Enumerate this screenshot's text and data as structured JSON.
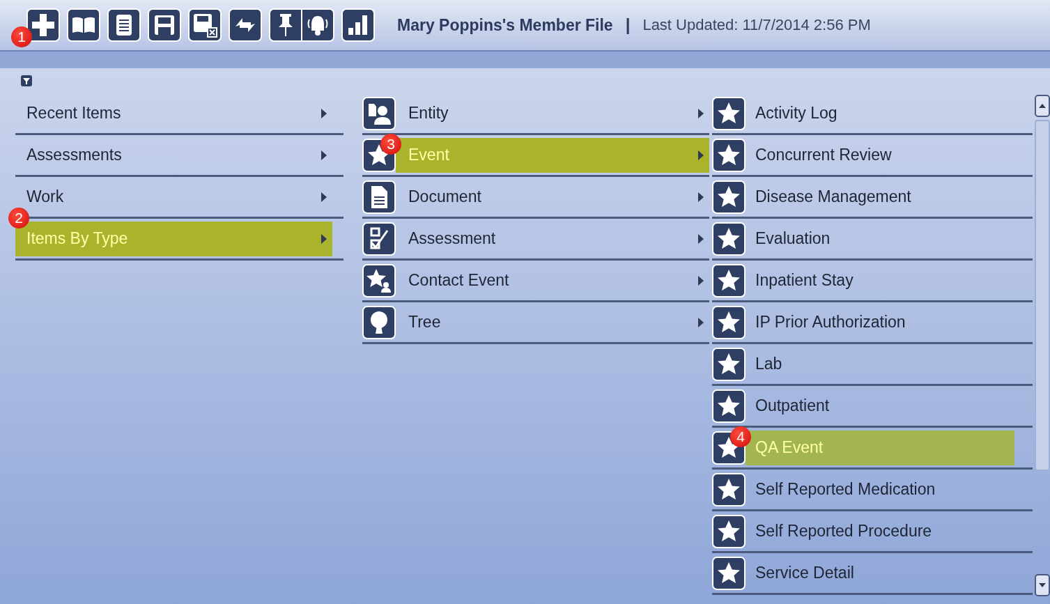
{
  "toolbar": {
    "buttons": [
      {
        "kind": "plus",
        "badge": "1"
      },
      {
        "kind": "book"
      },
      {
        "kind": "notepad"
      },
      {
        "kind": "save"
      },
      {
        "kind": "save-close"
      },
      {
        "kind": "refresh"
      },
      {
        "kind": "pin-bell"
      },
      {
        "kind": "chart"
      }
    ]
  },
  "header": {
    "title": "Mary Poppins's Member File",
    "separator": "|",
    "last_updated": "Last Updated: 11/7/2014 2:56 PM"
  },
  "menus": [
    {
      "items": [
        {
          "label": "Recent Items",
          "selected": false,
          "has_submenu": true
        },
        {
          "label": "Assessments",
          "selected": false,
          "has_submenu": true
        },
        {
          "label": "Work",
          "selected": false,
          "has_submenu": true
        },
        {
          "label": "Items By Type",
          "selected": true,
          "has_submenu": true,
          "badge": "2"
        }
      ]
    },
    {
      "items": [
        {
          "label": "Entity",
          "kind": "entity",
          "selected": false,
          "has_submenu": true
        },
        {
          "label": "Event",
          "kind": "star",
          "selected": true,
          "has_submenu": true,
          "badge": "3"
        },
        {
          "label": "Document",
          "kind": "document",
          "selected": false,
          "has_submenu": true
        },
        {
          "label": "Assessment",
          "kind": "assessment",
          "selected": false,
          "has_submenu": true
        },
        {
          "label": "Contact Event",
          "kind": "contact",
          "selected": false,
          "has_submenu": true
        },
        {
          "label": "Tree",
          "kind": "tree",
          "selected": false,
          "has_submenu": true
        }
      ]
    },
    {
      "items": [
        {
          "label": "Activity Log",
          "kind": "star",
          "selected": false,
          "has_submenu": false
        },
        {
          "label": "Concurrent Review",
          "kind": "star",
          "selected": false,
          "has_submenu": false
        },
        {
          "label": "Disease Management",
          "kind": "star",
          "selected": false,
          "has_submenu": false
        },
        {
          "label": "Evaluation",
          "kind": "star",
          "selected": false,
          "has_submenu": false
        },
        {
          "label": "Inpatient Stay",
          "kind": "star",
          "selected": false,
          "has_submenu": false
        },
        {
          "label": "IP Prior Authorization",
          "kind": "star",
          "selected": false,
          "has_submenu": false
        },
        {
          "label": "Lab",
          "kind": "star",
          "selected": false,
          "has_submenu": false
        },
        {
          "label": "Outpatient",
          "kind": "star",
          "selected": false,
          "has_submenu": false
        },
        {
          "label": "QA Event",
          "kind": "star",
          "selected": true,
          "has_submenu": false,
          "badge": "4"
        },
        {
          "label": "Self Reported Medication",
          "kind": "star",
          "selected": false,
          "has_submenu": false
        },
        {
          "label": "Self Reported Procedure",
          "kind": "star",
          "selected": false,
          "has_submenu": false
        },
        {
          "label": "Service Detail",
          "kind": "star",
          "selected": false,
          "has_submenu": false
        }
      ]
    }
  ]
}
